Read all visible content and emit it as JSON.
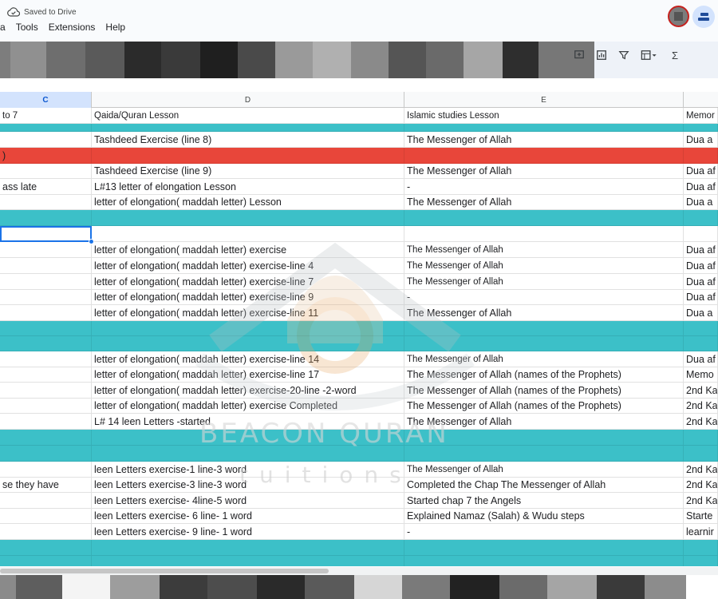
{
  "header": {
    "save_status": "Saved to Drive",
    "menus": [
      "a",
      "Tools",
      "Extensions",
      "Help"
    ]
  },
  "toolbar": {
    "icons": [
      "link-icon",
      "add-comment-icon",
      "insert-chart-icon",
      "filter-icon",
      "filter-views-icon",
      "functions-icon"
    ],
    "functions_symbol": "Σ",
    "filter_symbol": "Y"
  },
  "columns": [
    {
      "letter": "C",
      "selected": true
    },
    {
      "letter": "D",
      "selected": false
    },
    {
      "letter": "E",
      "selected": false
    }
  ],
  "rows": [
    {
      "type": "data",
      "h": 20,
      "c": "to 7",
      "d": "Qaida/Quran Lesson",
      "e": "Islamic studies Lesson",
      "f": "Memor",
      "small": true
    },
    {
      "type": "band",
      "h": 10,
      "c": "",
      "d": "",
      "e": "",
      "f": ""
    },
    {
      "type": "data",
      "h": 20,
      "c": "",
      "d": "Tashdeed Exercise (line 8)",
      "e": " The Messenger of Allah",
      "f": "Dua a"
    },
    {
      "type": "red",
      "h": 20,
      "c": ")",
      "d": "",
      "e": "",
      "f": ""
    },
    {
      "type": "data",
      "h": 19,
      "c": "",
      "d": "Tashdeed Exercise (line 9)",
      "e": " The Messenger of Allah",
      "f": "Dua af"
    },
    {
      "type": "data",
      "h": 20,
      "c": "ass late",
      "d": "L#13 letter of elongation Lesson",
      "e": "-",
      "f": "Dua af"
    },
    {
      "type": "data",
      "h": 19,
      "c": "",
      "d": "letter of elongation( maddah letter) Lesson",
      "e": " The Messenger of Allah",
      "f": "Dua a"
    },
    {
      "type": "band",
      "h": 20,
      "c": "",
      "d": "",
      "e": "",
      "f": ""
    },
    {
      "type": "data",
      "h": 20,
      "c": "",
      "d": "",
      "e": "",
      "f": ""
    },
    {
      "type": "data",
      "h": 20,
      "c": "",
      "d": "letter of elongation( maddah letter) exercise",
      "e": "The Messenger of Allah",
      "f": "Dua af",
      "esmall": true
    },
    {
      "type": "data",
      "h": 20,
      "c": "",
      "d": "letter of elongation( maddah letter) exercise-line 4",
      "e": "The Messenger of Allah",
      "f": "Dua af",
      "esmall": true
    },
    {
      "type": "data",
      "h": 20,
      "c": "",
      "d": "letter of elongation( maddah letter) exercise-line 7",
      "e": "The Messenger of Allah",
      "f": "Dua af",
      "esmall": true
    },
    {
      "type": "data",
      "h": 19,
      "c": "",
      "d": "letter of elongation( maddah letter) exercise-line 9",
      "e": "-",
      "f": "Dua af"
    },
    {
      "type": "data",
      "h": 20,
      "c": "",
      "d": "letter of elongation( maddah letter) exercise-line 11",
      "e": "The Messenger of Allah",
      "f": "Dua a"
    },
    {
      "type": "band",
      "h": 19,
      "c": "",
      "d": "",
      "e": "",
      "f": ""
    },
    {
      "type": "band",
      "h": 19,
      "c": "",
      "d": "",
      "e": "",
      "f": ""
    },
    {
      "type": "data",
      "h": 20,
      "c": "",
      "d": "letter of elongation( maddah letter) exercise-line 14",
      "e": "The Messenger of Allah",
      "f": "Dua af",
      "esmall": true
    },
    {
      "type": "data",
      "h": 19,
      "c": "",
      "d": "letter of elongation( maddah letter) exercise-line 17",
      "e": "The Messenger of Allah (names of the Prophets)",
      "f": " Memo"
    },
    {
      "type": "data",
      "h": 20,
      "c": "",
      "d": "letter of elongation( maddah letter) exercise-20-line -2-word",
      "e": "The Messenger of Allah (names of the Prophets)",
      "f": "2nd Ka"
    },
    {
      "type": "data",
      "h": 19,
      "c": "",
      "d": "letter of elongation( maddah letter) exercise Completed",
      "e": "The Messenger of Allah (names of the Prophets)",
      "f": "2nd Ka"
    },
    {
      "type": "data",
      "h": 20,
      "c": "",
      "d": "L# 14 leen Letters -started",
      "e": "The Messenger of Allah",
      "f": "2nd Ka"
    },
    {
      "type": "band",
      "h": 20,
      "c": "",
      "d": "",
      "e": "",
      "f": ""
    },
    {
      "type": "band",
      "h": 20,
      "c": "",
      "d": "",
      "e": "",
      "f": ""
    },
    {
      "type": "data",
      "h": 20,
      "c": "",
      "d": "leen Letters exercise-1 line-3 word",
      "e": "The Messenger of Allah",
      "f": "2nd Ka",
      "esmall": true
    },
    {
      "type": "data",
      "h": 19,
      "c": "se they have",
      "d": "leen Letters exercise-3 line-3 word",
      "e": "Completed the Chap The Messenger of Allah",
      "f": "2nd Ka"
    },
    {
      "type": "data",
      "h": 20,
      "c": "",
      "d": "leen Letters exercise- 4line-5 word",
      "e": "Started chap 7 the Angels",
      "f": "2nd Ka"
    },
    {
      "type": "data",
      "h": 19,
      "c": "",
      "d": "leen Letters exercise- 6 line- 1 word",
      "e": "Explained Namaz (Salah) & Wudu steps",
      "f": "Starte"
    },
    {
      "type": "data",
      "h": 20,
      "c": "",
      "d": "leen Letters exercise- 9 line- 1 word",
      "e": "-",
      "f": "learnir"
    },
    {
      "type": "band",
      "h": 20,
      "c": "",
      "d": "",
      "e": "",
      "f": ""
    },
    {
      "type": "band",
      "h": 14,
      "c": "",
      "d": "",
      "e": "",
      "f": ""
    }
  ],
  "watermark": {
    "line1": "BEACON QURAN",
    "line2": "tuitions"
  }
}
